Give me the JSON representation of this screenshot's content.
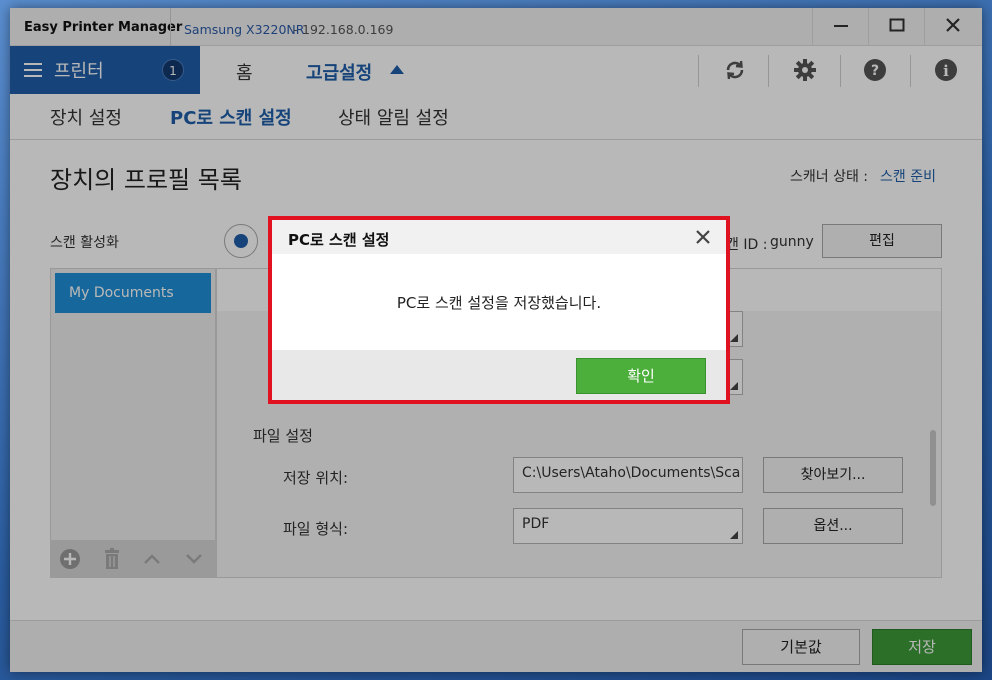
{
  "window": {
    "app_title": "Easy Printer Manager",
    "device_name": "Samsung X3220NR",
    "device_sep": "-",
    "device_ip": "192.168.0.169",
    "controls": [
      "minimize-icon",
      "maximize-icon",
      "close-icon"
    ]
  },
  "nav": {
    "printer_label": "프린터",
    "printer_count": "1",
    "home": "홈",
    "advanced": "고급설정",
    "tools": [
      "refresh-icon",
      "gear-icon",
      "help-icon",
      "info-icon"
    ]
  },
  "subnav": {
    "tabs": [
      {
        "label": "장치 설정",
        "active": false
      },
      {
        "label": "PC로 스캔 설정",
        "active": true
      },
      {
        "label": "상태 알림 설정",
        "active": false
      }
    ]
  },
  "main": {
    "title": "장치의 프로필 목록",
    "scanner_status_label": "스캐너 상태 :",
    "scanner_status_value": "스캔 준비",
    "scan_enable_label": "스캔 활성화",
    "scan_id_label": "캔 ID :",
    "scan_id_value": "gunny",
    "edit_button": "편집",
    "profiles": [
      "My Documents"
    ],
    "file_settings": {
      "section": "파일 설정",
      "save_location_label": "저장 위치:",
      "save_location_value": "C:\\Users\\Ataho\\Documents\\Sca",
      "browse_button": "찾아보기...",
      "file_format_label": "파일 형식:",
      "file_format_value": "PDF",
      "options_button": "옵션..."
    }
  },
  "footer": {
    "default_button": "기본값",
    "save_button": "저장"
  },
  "dialog": {
    "title": "PC로 스캔 설정",
    "message": "PC로 스캔 설정을 저장했습니다.",
    "ok_button": "확인"
  },
  "colors": {
    "accent": "#1f5fa9",
    "profile_selected": "#1f8fd8",
    "save_green": "#3e9a3a",
    "highlight_red": "#e0121f"
  }
}
